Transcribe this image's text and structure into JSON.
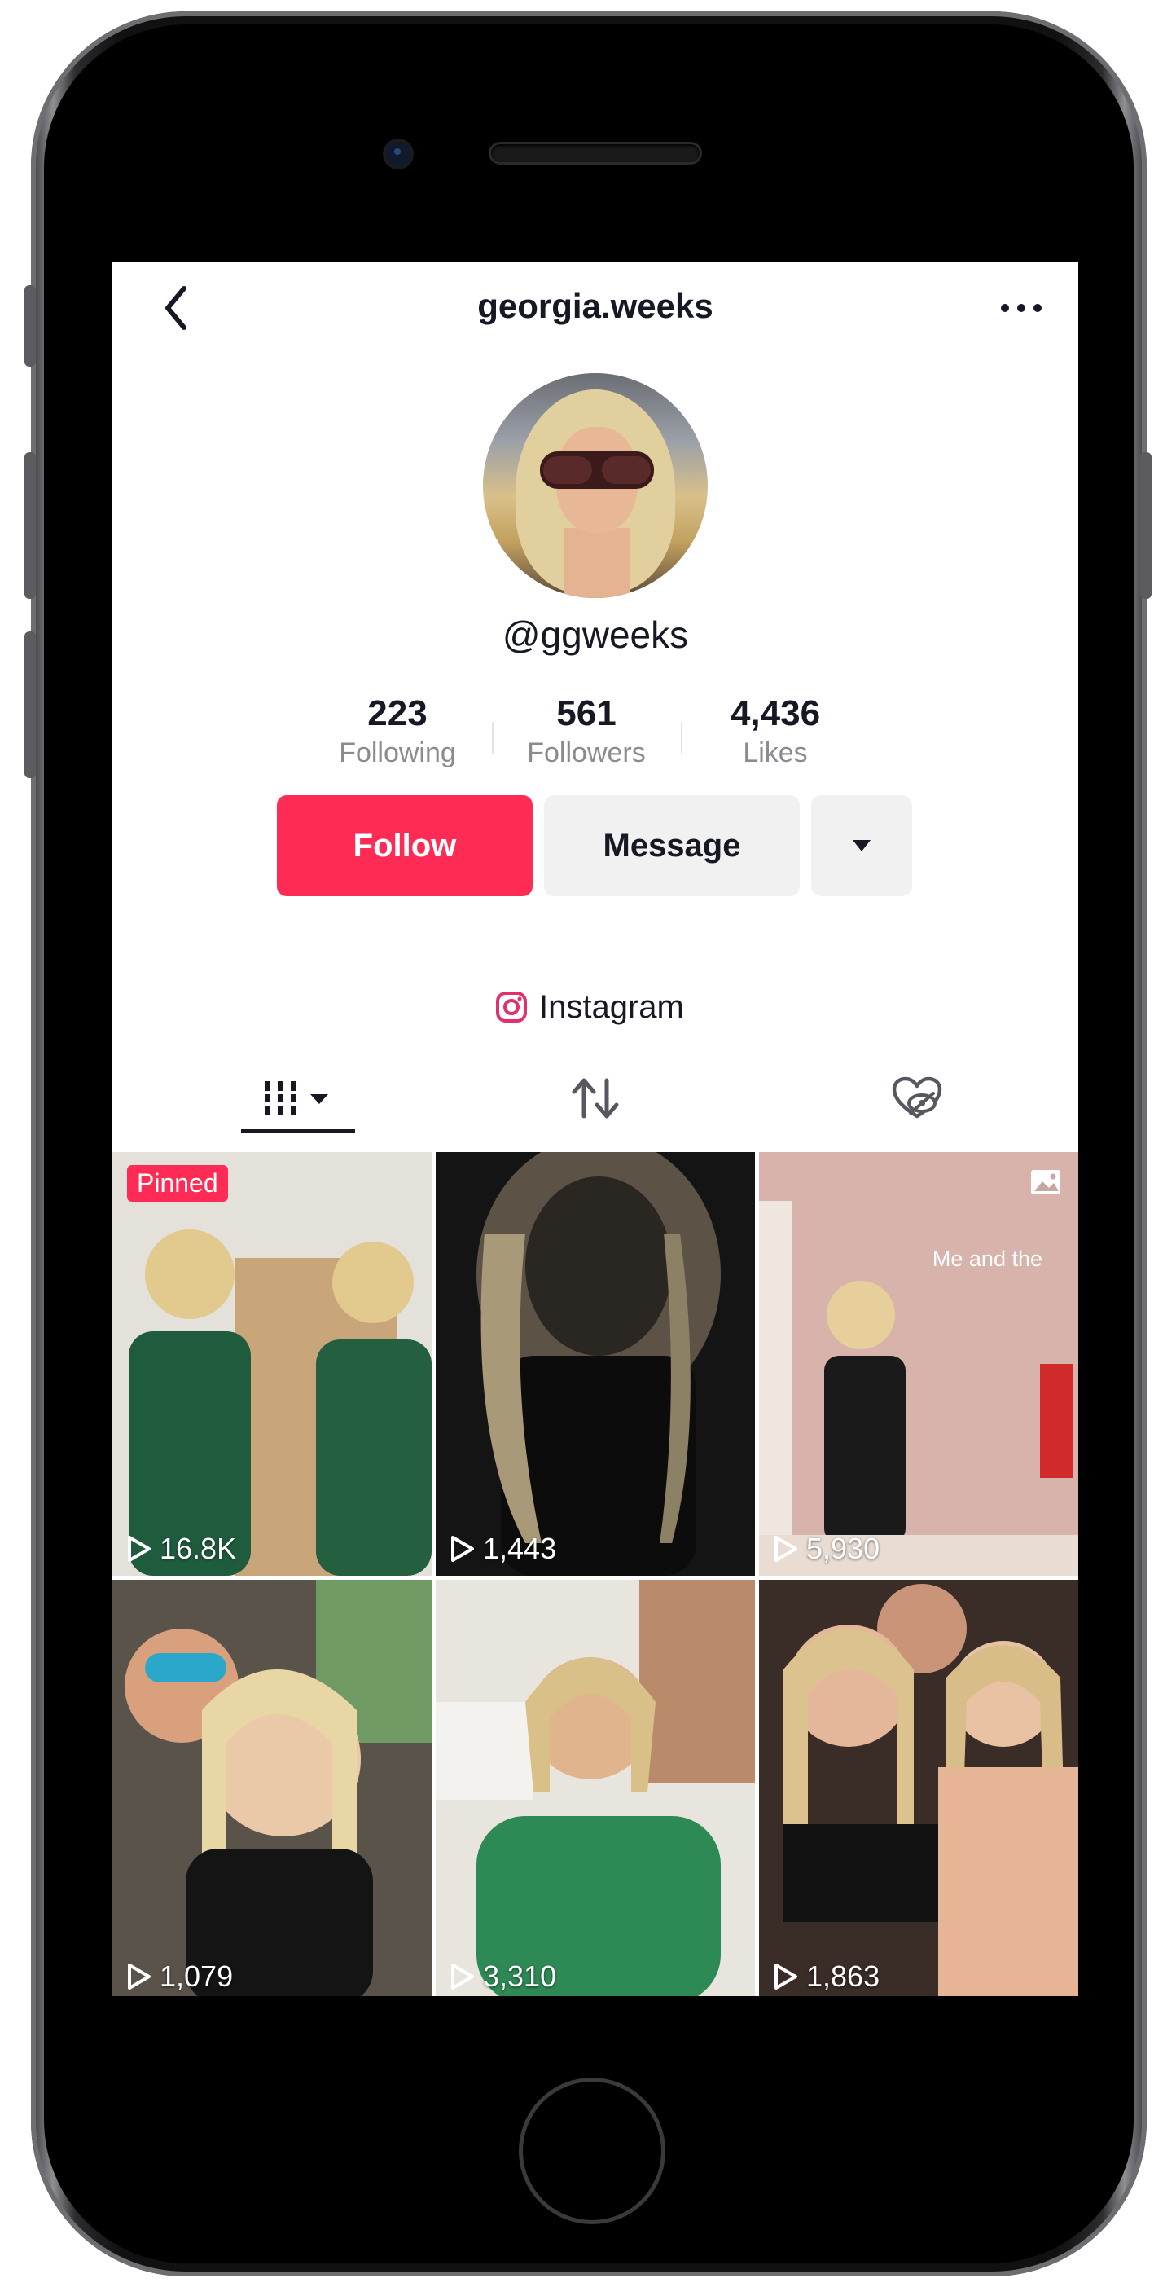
{
  "profile": {
    "title": "georgia.weeks",
    "handle": "@ggweeks",
    "stats": [
      {
        "value": "223",
        "label": "Following"
      },
      {
        "value": "561",
        "label": "Followers"
      },
      {
        "value": "4,436",
        "label": "Likes"
      }
    ],
    "follow_label": "Follow",
    "message_label": "Message",
    "link_label": "Instagram"
  },
  "tabs": {
    "videos_icon": "grid-icon",
    "reposts_icon": "repost-icon",
    "liked_icon": "hidden-likes-icon",
    "active": "videos"
  },
  "videos": [
    {
      "views": "16.8K",
      "pinned_label": "Pinned",
      "bg": "#5b7a55"
    },
    {
      "views": "1,443",
      "bg": "#1b1b1b"
    },
    {
      "views": "5,930",
      "caption": "Me and the",
      "type": "photo",
      "bg": "#c9a7a1"
    },
    {
      "views": "1,079",
      "bg": "#4a463f"
    },
    {
      "views": "3,310",
      "bg": "#2f8a55"
    },
    {
      "views": "1,863",
      "bg": "#3a2c26"
    }
  ],
  "colors": {
    "accent": "#fe2c55",
    "text": "#161823",
    "muted": "#8a8b91"
  }
}
